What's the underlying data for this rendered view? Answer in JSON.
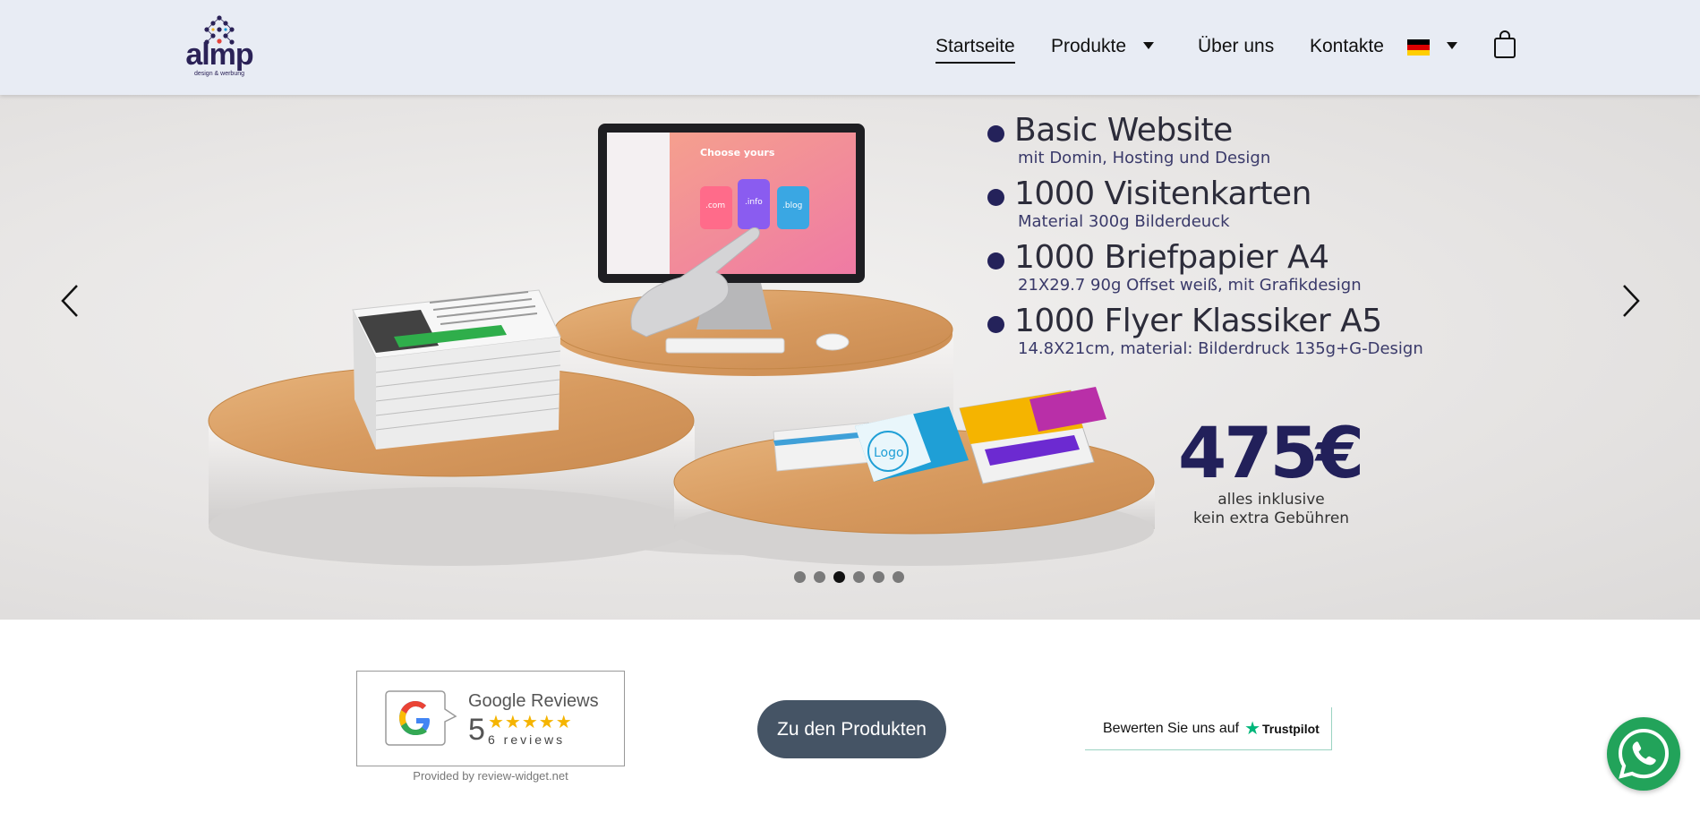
{
  "header": {
    "logo_text": "almp",
    "logo_tagline": "design & werbung",
    "nav": [
      {
        "label": "Startseite",
        "active": true
      },
      {
        "label": "Produkte",
        "has_dropdown": true
      },
      {
        "label": "Über uns"
      },
      {
        "label": "Kontakte"
      }
    ],
    "language": {
      "flag": "de-flag-icon",
      "colors": [
        "#000000",
        "#dd0000",
        "#ffce00"
      ]
    },
    "cart_icon": "shopping-bag-icon"
  },
  "hero": {
    "screen_title": "Choose yours",
    "domains": [
      ".com",
      ".info",
      ".blog"
    ],
    "logo_card_text": "Logo",
    "offers": [
      {
        "title": "Basic Website",
        "subtitle": "mit Domin, Hosting und Design"
      },
      {
        "title": "1000 Visitenkarten",
        "subtitle": "Material 300g Bilderdeuck"
      },
      {
        "title": "1000 Briefpapier A4",
        "subtitle": "21X29.7 90g Offset weiß, mit Grafikdesign"
      },
      {
        "title": "1000 Flyer Klassiker A5",
        "subtitle": "14.8X21cm, material: Bilderdruck 135g+G-Design"
      }
    ],
    "price": "475€",
    "price_note_1": "alles inklusive",
    "price_note_2": "kein extra Gebühren",
    "slide_count": 6,
    "active_slide": 3,
    "accent_color": "#24225a"
  },
  "reviews": {
    "title": "Google Reviews",
    "score": "5",
    "stars": "★★★★★",
    "count": "6 reviews",
    "provided_by": "Provided by review-widget.net"
  },
  "cta": {
    "label": "Zu den Produkten",
    "color": "#455465"
  },
  "trustpilot": {
    "text": "Bewerten Sie uns auf",
    "brand": "Trustpilot",
    "star": "★"
  },
  "whatsapp": {
    "icon": "whatsapp-icon",
    "color": "#22a35a"
  }
}
